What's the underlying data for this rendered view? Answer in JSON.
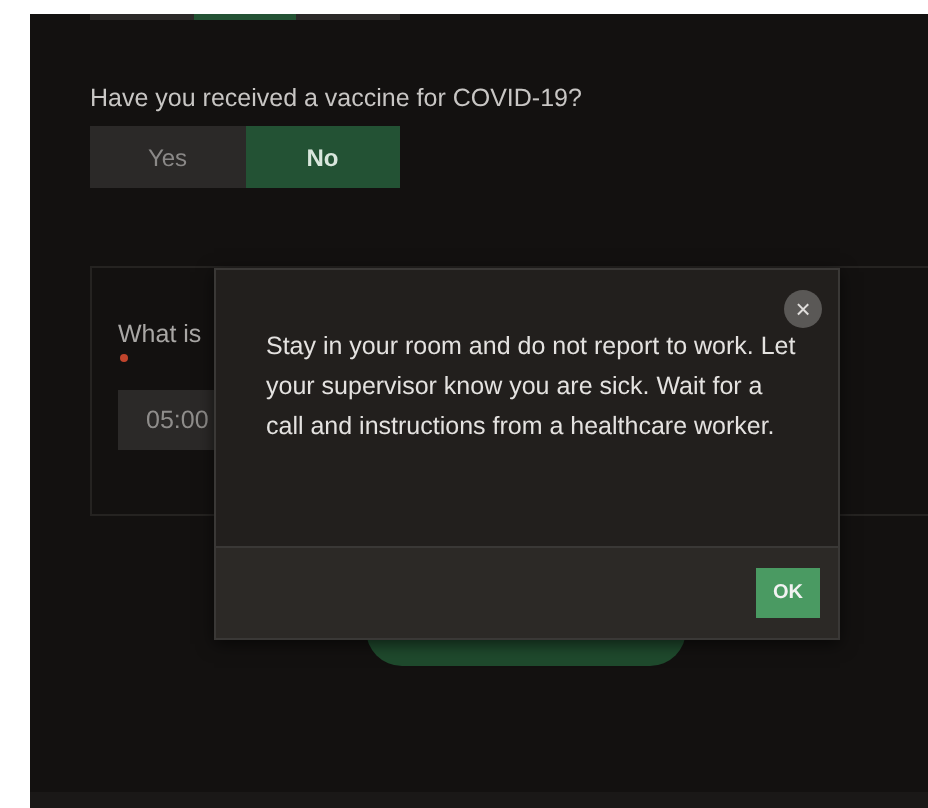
{
  "previous_question": {
    "options": [
      {
        "selected": false
      },
      {
        "selected": true
      },
      {
        "selected": false
      }
    ]
  },
  "vaccine_question": {
    "label": "Have you received a vaccine for COVID-19?",
    "options": [
      {
        "label": "Yes",
        "selected": false
      },
      {
        "label": "No",
        "selected": true
      }
    ]
  },
  "time_question": {
    "label": "What is",
    "required": true,
    "value": "05:00"
  },
  "dialog": {
    "message": "Stay in your room and do not report to work. Let your supervisor know you are sick. Wait for a call and instructions from a healthcare worker.",
    "close": "×",
    "button": "OK"
  }
}
